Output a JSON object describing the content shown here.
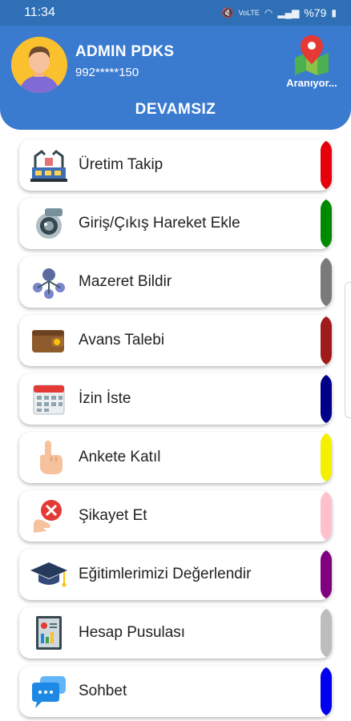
{
  "statusbar": {
    "time": "11:34",
    "network": "VoLTE",
    "battery": "%79"
  },
  "header": {
    "user_name": "ADMIN PDKS",
    "user_phone": "992*****150",
    "location_label": "Aranıyor...",
    "status_title": "DEVAMSIZ"
  },
  "menu": {
    "items": [
      {
        "label": "Üretim Takip",
        "icon": "factory-icon",
        "accent": "#e5000b"
      },
      {
        "label": "Giriş/Çıkış Hareket Ekle",
        "icon": "camera-icon",
        "accent": "#008a00"
      },
      {
        "label": "Mazeret Bildir",
        "icon": "network-people-icon",
        "accent": "#7a7a7a"
      },
      {
        "label": "Avans Talebi",
        "icon": "wallet-icon",
        "accent": "#a01c1c"
      },
      {
        "label": "İzin İste",
        "icon": "calendar-icon",
        "accent": "#00008b"
      },
      {
        "label": "Ankete Katıl",
        "icon": "pointing-hand-icon",
        "accent": "#f5f000"
      },
      {
        "label": "Şikayet Et",
        "icon": "complaint-hand-icon",
        "accent": "#ffc0cb"
      },
      {
        "label": "Eğitimlerimizi Değerlendir",
        "icon": "graduation-cap-icon",
        "accent": "#800080"
      },
      {
        "label": "Hesap Pusulası",
        "icon": "report-icon",
        "accent": "#bdbdbd"
      },
      {
        "label": "Sohbet",
        "icon": "chat-icon",
        "accent": "#0000ee"
      }
    ]
  }
}
